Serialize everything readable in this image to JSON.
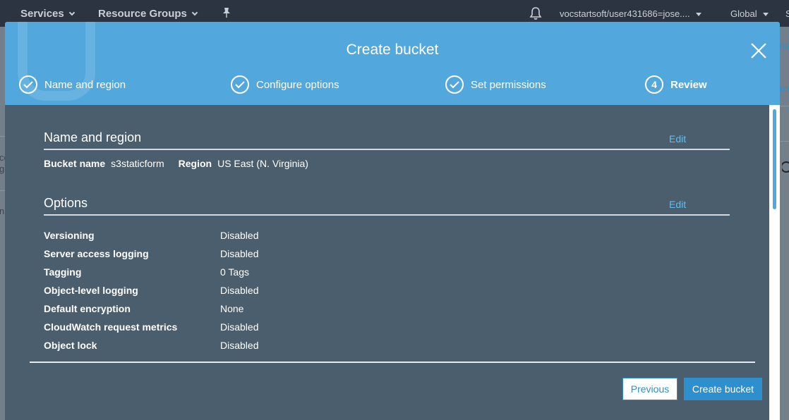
{
  "topnav": {
    "services": "Services",
    "resource_groups": "Resource Groups",
    "account": "vocstartsoft/user431686=jose....",
    "region": "Global",
    "edge_right": "S"
  },
  "background": {
    "left_fragments": [
      "co",
      "gs",
      "ni"
    ],
    "right_fragments": [
      "nta",
      "ns"
    ]
  },
  "modal": {
    "title": "Create bucket",
    "steps": [
      {
        "label": "Name and region",
        "state": "done"
      },
      {
        "label": "Configure options",
        "state": "done"
      },
      {
        "label": "Set permissions",
        "state": "done"
      },
      {
        "label": "Review",
        "state": "active",
        "number": "4"
      }
    ],
    "name_region": {
      "title": "Name and region",
      "edit": "Edit",
      "bucket_name_label": "Bucket name",
      "bucket_name_value": "s3staticform",
      "region_label": "Region",
      "region_value": "US East (N. Virginia)"
    },
    "options": {
      "title": "Options",
      "edit": "Edit",
      "rows": [
        {
          "key": "Versioning",
          "value": "Disabled"
        },
        {
          "key": "Server access logging",
          "value": "Disabled"
        },
        {
          "key": "Tagging",
          "value": "0 Tags"
        },
        {
          "key": "Object-level logging",
          "value": "Disabled"
        },
        {
          "key": "Default encryption",
          "value": "None"
        },
        {
          "key": "CloudWatch request metrics",
          "value": "Disabled"
        },
        {
          "key": "Object lock",
          "value": "Disabled"
        }
      ]
    },
    "buttons": {
      "previous": "Previous",
      "create": "Create bucket"
    }
  },
  "colors": {
    "header_blue": "#52a8dc",
    "modal_body": "#4b5e6d",
    "primary_button": "#2e8fcf",
    "link": "#5cc0f2",
    "nav_bg": "#2b3440"
  }
}
